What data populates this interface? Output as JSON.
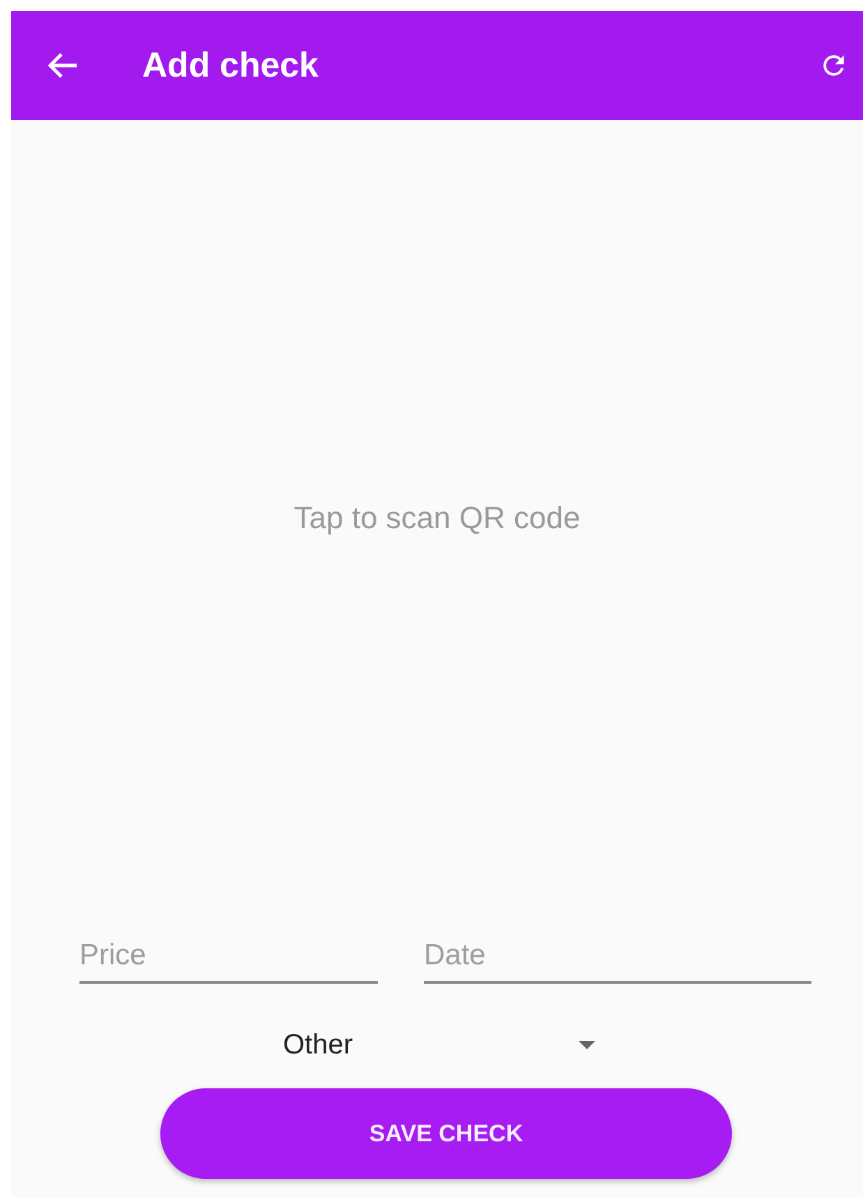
{
  "app_bar": {
    "title": "Add check"
  },
  "scan_area": {
    "prompt": "Tap to scan QR code"
  },
  "fields": [
    {
      "placeholder": "Price"
    },
    {
      "placeholder": "Date"
    }
  ],
  "category": {
    "value": "Other"
  },
  "save_button": {
    "label": "SAVE CHECK"
  }
}
